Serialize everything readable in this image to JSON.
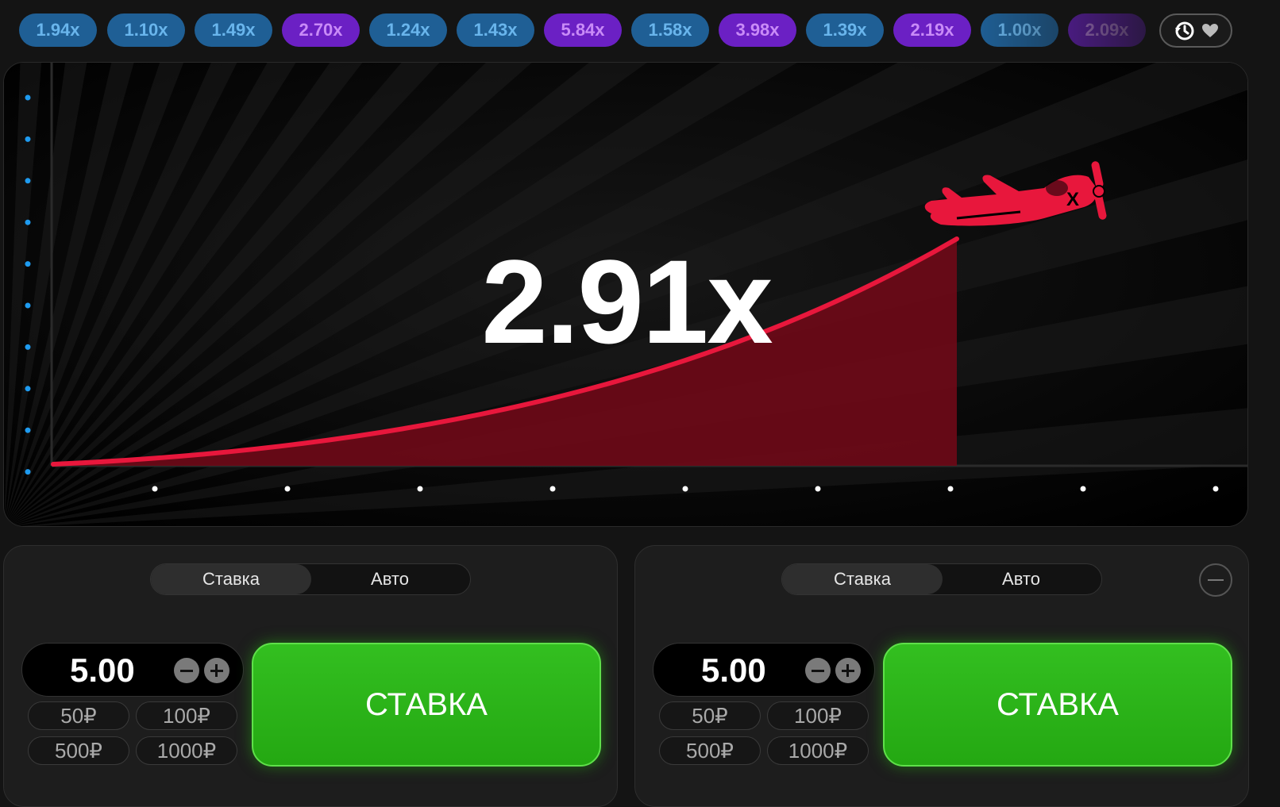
{
  "history": {
    "multipliers": [
      {
        "value": "1.94x",
        "color": "blue"
      },
      {
        "value": "1.10x",
        "color": "blue"
      },
      {
        "value": "1.49x",
        "color": "blue"
      },
      {
        "value": "2.70x",
        "color": "purple"
      },
      {
        "value": "1.24x",
        "color": "blue"
      },
      {
        "value": "1.43x",
        "color": "blue"
      },
      {
        "value": "5.84x",
        "color": "purple"
      },
      {
        "value": "1.58x",
        "color": "blue"
      },
      {
        "value": "3.98x",
        "color": "purple"
      },
      {
        "value": "1.39x",
        "color": "blue"
      },
      {
        "value": "2.19x",
        "color": "purple"
      },
      {
        "value": "1.00x",
        "color": "blue"
      },
      {
        "value": "2.09x",
        "color": "purple"
      }
    ],
    "button_icons": [
      "history-icon",
      "chevron-down-icon"
    ]
  },
  "game": {
    "multiplier": "2.91x",
    "plane_mark": "X",
    "colors": {
      "curve": "#e8173c",
      "fill": "#6a0a17",
      "axis_dot_left": "#1e9bf0",
      "axis_dot_bottom": "#ffffff"
    }
  },
  "panels": [
    {
      "tab_bet": "Ставка",
      "tab_auto": "Авто",
      "amount": "5.00",
      "quick": [
        "50₽",
        "100₽",
        "500₽",
        "1000₽"
      ],
      "bet_label": "СТАВКА"
    },
    {
      "tab_bet": "Ставка",
      "tab_auto": "Авто",
      "amount": "5.00",
      "quick": [
        "50₽",
        "100₽",
        "500₽",
        "1000₽"
      ],
      "bet_label": "СТАВКА"
    }
  ],
  "colors": {
    "bet_green": "#2ab51a",
    "chip_blue": "#1f5f95",
    "chip_purple": "#6b20c4"
  }
}
